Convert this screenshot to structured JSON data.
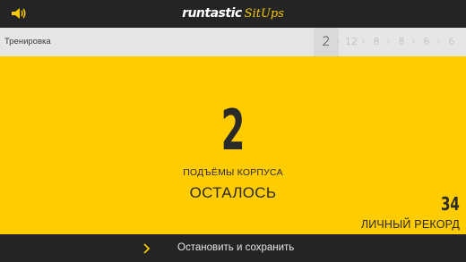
{
  "header": {
    "brand": "runtastic",
    "product": "SitUps",
    "speaker_icon": "speaker-volume-icon",
    "accent_color": "#f6c900"
  },
  "workout": {
    "label": "Тренировка",
    "sets": [
      "2",
      "12",
      "8",
      "8",
      "6",
      "6"
    ],
    "active_index": 0
  },
  "counter": {
    "value": "2",
    "unit": "ПОДЪЁМЫ КОРПУСА",
    "status": "ОСТАЛОСЬ",
    "background_color": "#ffcc00"
  },
  "personal_record": {
    "value": "34",
    "label": "ЛИЧНЫЙ РЕКОРД"
  },
  "footer": {
    "chevron_icon": "chevron-right-icon",
    "action_label": "Остановить и сохранить"
  }
}
